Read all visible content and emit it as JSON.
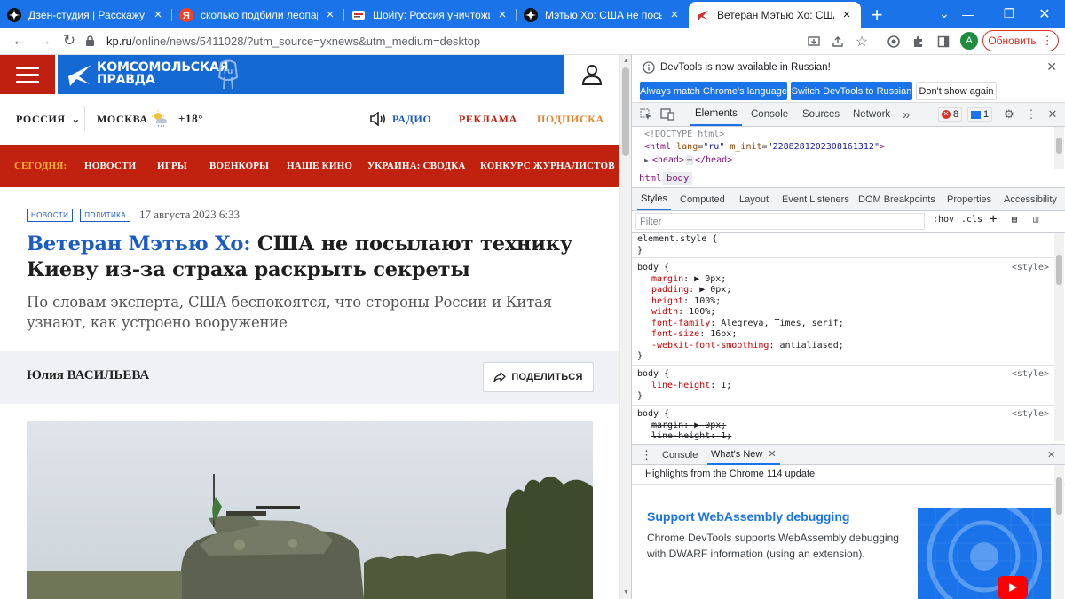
{
  "browser": {
    "tabs": [
      {
        "title": "Дзен-студия | Расскажу: чег",
        "icon": "dzen-icon"
      },
      {
        "title": "сколько подбили леопардо",
        "icon": "yandex-icon"
      },
      {
        "title": "Шойгу: Россия уничтожила",
        "icon": "news-icon"
      },
      {
        "title": "Мэтью Хо: США не посыла",
        "icon": "dzen-icon"
      },
      {
        "title": "Ветеран Мэтью Хо: США не",
        "icon": "kp-icon"
      }
    ],
    "url_host": "kp.ru",
    "url_rest": "/online/news/5411028/?utm_source=yxnews&utm_medium=desktop",
    "profile_initial": "A",
    "update_label": "Обновить",
    "accent_color": "#1a73e8"
  },
  "site": {
    "logo_line1": "КОМСОМОЛЬСКАЯ",
    "logo_line2": "ПРАВДА",
    "logo_badge": "ru",
    "region": "РОССИЯ",
    "city": "МОСКВА",
    "temperature": "+18°",
    "radio": "РАДИО",
    "ads": "РЕКЛАМА",
    "subscribe": "ПОДПИСКА",
    "brand_red": "#c1210f",
    "brand_blue": "#1569d3",
    "nav": {
      "today": "СЕГОДНЯ:",
      "items": [
        "НОВОСТИ",
        "ИГРЫ",
        "ВОЕНКОРЫ",
        "НАШЕ КИНО",
        "УКРАИНА: СВОДКА",
        "КОНКУРС ЖУРНАЛИСТОВ"
      ]
    }
  },
  "article": {
    "tags": [
      "НОВОСТИ",
      "ПОЛИТИКА"
    ],
    "date": "17 августа 2023 6:33",
    "headline_accent": "Ветеран Мэтью Хо:",
    "headline_rest": " США не посылают технику Киеву из-за страха раскрыть секреты",
    "lead": "По словам эксперта, США беспокоятся, что стороны России и Китая узнают, как устроено вооружение",
    "author": "Юлия ВАСИЛЬЕВА",
    "share": "ПОДЕЛИТЬСЯ"
  },
  "devtools": {
    "infobar_text": "DevTools is now available in Russian!",
    "btn_match": "Always match Chrome's language",
    "btn_switch": "Switch DevTools to Russian",
    "btn_dont": "Don't show again",
    "tabs": [
      "Elements",
      "Console",
      "Sources",
      "Network"
    ],
    "errors_count": "8",
    "messages_count": "1",
    "dom": {
      "doctype": "<!DOCTYPE html>",
      "html_open": "<html",
      "attr_lang": "lang",
      "val_lang": "\"ru\"",
      "attr_minit": "m_init",
      "val_minit": "\"2288281202308161312\"",
      "head_line": "<head>",
      "head_close": "</head>"
    },
    "crumbs": [
      "html",
      "body"
    ],
    "sub_tabs": [
      "Styles",
      "Computed",
      "Layout",
      "Event Listeners",
      "DOM Breakpoints",
      "Properties",
      "Accessibility"
    ],
    "filter_placeholder": "Filter",
    "hov": ":hov",
    "cls": ".cls",
    "styles": {
      "element_style": "element.style {",
      "close": "}",
      "body_sel": "body {",
      "src": "<style>",
      "rule1": [
        {
          "name": "margin",
          "value": "▶ 0px;"
        },
        {
          "name": "padding",
          "value": "▶ 0px;"
        },
        {
          "name": "height",
          "value": "100%;"
        },
        {
          "name": "width",
          "value": "100%;"
        },
        {
          "name": "font-family",
          "value": "Alegreya, Times, serif;"
        },
        {
          "name": "font-size",
          "value": "16px;"
        },
        {
          "name": "-webkit-font-smoothing",
          "value": "antialiased;"
        }
      ],
      "rule2": [
        {
          "name": "line-height",
          "value": "1;"
        }
      ],
      "rule3": [
        "margin: ▶ 0px;",
        "line-height: 1;"
      ]
    },
    "drawer_tabs": [
      "Console",
      "What's New"
    ],
    "whatsnew_head": "Highlights from the Chrome 114 update",
    "whatsnew_title": "Support WebAssembly debugging",
    "whatsnew_desc": "Chrome DevTools supports WebAssembly debugging with DWARF information (using an extension)."
  }
}
